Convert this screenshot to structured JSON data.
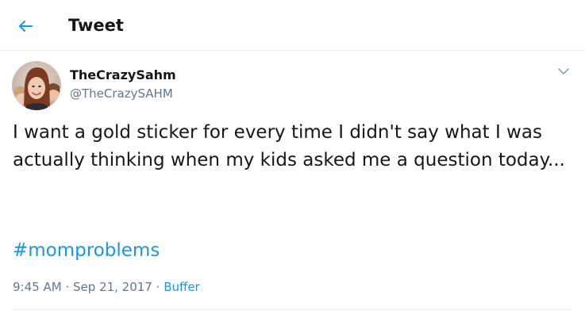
{
  "header": {
    "title": "Tweet",
    "back_icon": "back-arrow-icon"
  },
  "tweet": {
    "author": {
      "name": "TheCrazySahm",
      "handle": "@TheCrazySAHM",
      "avatar_icon": "avatar-photo"
    },
    "menu_icon": "chevron-down-icon",
    "text": "I want a gold sticker for every time I didn't say what I was actually thinking when my kids asked me a question today...",
    "hashtag": "#momproblems",
    "time": "9:45 AM",
    "separator": "·",
    "date": "Sep 21, 2017",
    "source": "Buffer"
  },
  "colors": {
    "accent": "#1b95e0",
    "text_primary": "#14171a",
    "text_secondary": "#657786",
    "divider": "#e6ecf0"
  }
}
